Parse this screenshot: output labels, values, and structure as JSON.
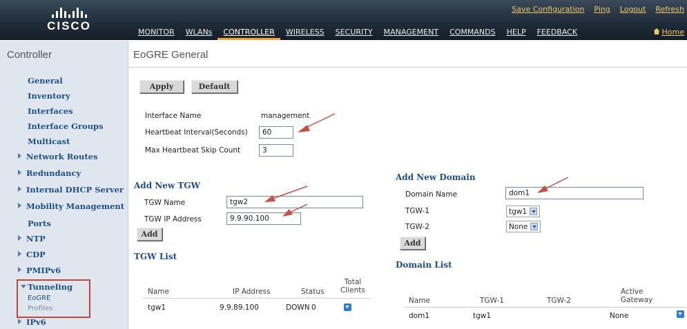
{
  "brand": {
    "name": "CISCO"
  },
  "top_links": [
    "Save Configuration",
    "Ping",
    "Logout",
    "Refresh"
  ],
  "nav": [
    "MONITOR",
    "WLANs",
    "CONTROLLER",
    "WIRELESS",
    "SECURITY",
    "MANAGEMENT",
    "COMMANDS",
    "HELP",
    "FEEDBACK"
  ],
  "home_label": "Home",
  "sidebar": {
    "title": "Controller",
    "items": [
      "General",
      "Inventory",
      "Interfaces",
      "Interface Groups",
      "Multicast"
    ],
    "expandable": [
      "Network Routes",
      "Redundancy",
      "Internal DHCP Server",
      "Mobility Management"
    ],
    "ports": "Ports",
    "expandable2": [
      "NTP",
      "CDP",
      "PMIPv6"
    ],
    "tunneling": {
      "label": "Tunneling",
      "children": [
        "EoGRE",
        "Profiles"
      ]
    },
    "after": [
      "IPv6"
    ]
  },
  "page": {
    "title": "EoGRE General",
    "apply_label": "Apply",
    "default_label": "Default",
    "interface_name_label": "Interface Name",
    "interface_name_value": "management",
    "heartbeat_label": "Heartbeat Interval(Seconds)",
    "heartbeat_value": "60",
    "skip_label": "Max Heartbeat Skip Count",
    "skip_value": "3"
  },
  "add_tgw": {
    "title": "Add New TGW",
    "name_label": "TGW Name",
    "name_value": "tgw2",
    "ip_label": "TGW IP Address",
    "ip_value": "9.9.90.100",
    "add_label": "Add"
  },
  "tgw_list": {
    "title": "TGW List",
    "headers": [
      "Name",
      "IP Address",
      "Status",
      "Total\nClients"
    ],
    "rows": [
      {
        "name": "tgw1",
        "ip": "9.9.89.100",
        "status": "DOWN",
        "clients": "0"
      }
    ]
  },
  "add_domain": {
    "title": "Add New Domain",
    "name_label": "Domain Name",
    "name_value": "dom1",
    "tgw1_label": "TGW-1",
    "tgw1_value": "tgw1",
    "tgw2_label": "TGW-2",
    "tgw2_value": "None",
    "add_label": "Add"
  },
  "domain_list": {
    "title": "Domain List",
    "headers": [
      "Name",
      "TGW-1",
      "TGW-2",
      "Active\nGateway"
    ],
    "rows": [
      {
        "name": "dom1",
        "tgw1": "tgw1",
        "tgw2": "",
        "active": "None"
      }
    ]
  },
  "colors": {
    "accent": "#f0a630",
    "link": "#1e4e8c",
    "highlight_box": "#c1453c",
    "arrow": "#c85040"
  }
}
